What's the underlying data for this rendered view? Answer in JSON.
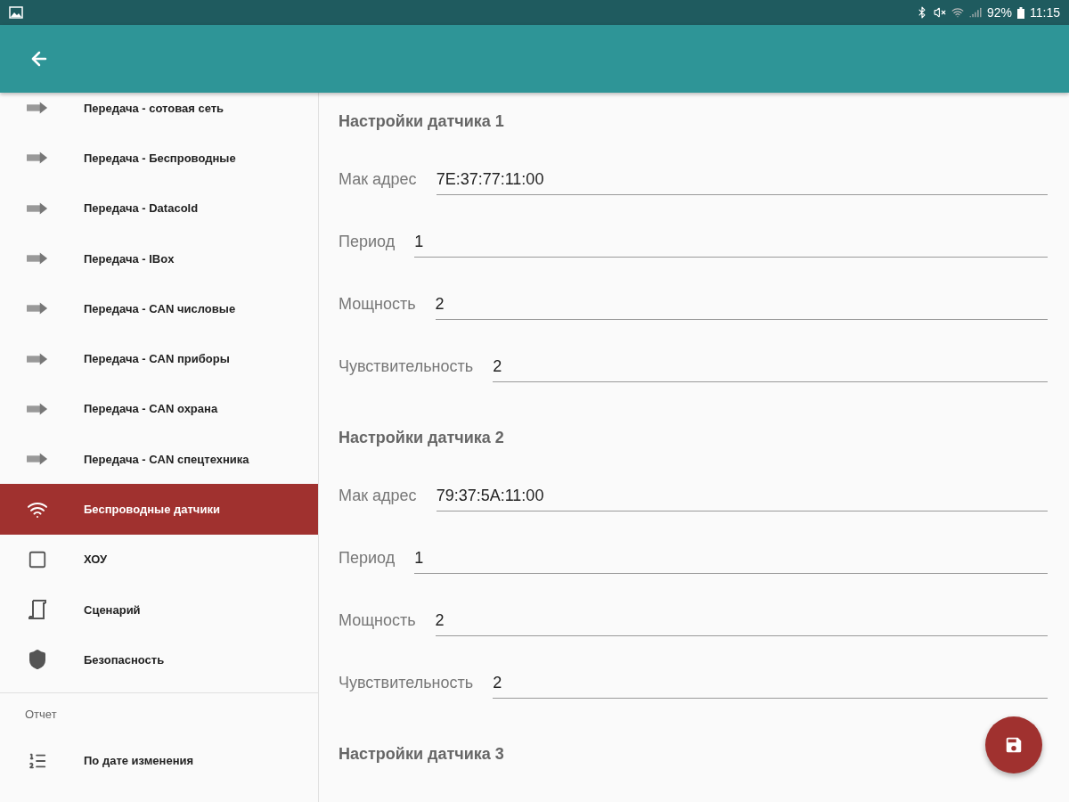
{
  "status_bar": {
    "battery_text": "92%",
    "time": "11:15"
  },
  "sidebar": {
    "items": [
      {
        "label": "Передача - сотовая сеть",
        "kind": "transfer",
        "selected": false
      },
      {
        "label": "Передача - Беспроводные",
        "kind": "transfer",
        "selected": false
      },
      {
        "label": "Передача - Datacold",
        "kind": "transfer",
        "selected": false
      },
      {
        "label": "Передача - IBox",
        "kind": "transfer",
        "selected": false
      },
      {
        "label": "Передача - CAN числовые",
        "kind": "transfer",
        "selected": false
      },
      {
        "label": "Передача - CAN приборы",
        "kind": "transfer",
        "selected": false
      },
      {
        "label": "Передача - CAN охрана",
        "kind": "transfer",
        "selected": false
      },
      {
        "label": "Передача - CAN спецтехника",
        "kind": "transfer",
        "selected": false
      },
      {
        "label": "Беспроводные датчики",
        "kind": "wireless",
        "selected": true
      },
      {
        "label": "ХОУ",
        "kind": "box",
        "selected": false
      },
      {
        "label": "Сценарий",
        "kind": "script",
        "selected": false
      },
      {
        "label": "Безопасность",
        "kind": "security",
        "selected": false
      }
    ],
    "report": {
      "title": "Отчет",
      "items": [
        {
          "label": "По дате изменения",
          "kind": "list",
          "selected": false
        }
      ]
    }
  },
  "sections": [
    {
      "title": "Настройки датчика 1",
      "fields": [
        {
          "label": "Мак адрес",
          "value": "7E:37:77:11:00"
        },
        {
          "label": "Период",
          "value": "1"
        },
        {
          "label": "Мощность",
          "value": "2"
        },
        {
          "label": "Чувствительность",
          "value": "2"
        }
      ]
    },
    {
      "title": "Настройки датчика 2",
      "fields": [
        {
          "label": "Мак адрес",
          "value": "79:37:5A:11:00"
        },
        {
          "label": "Период",
          "value": "1"
        },
        {
          "label": "Мощность",
          "value": "2"
        },
        {
          "label": "Чувствительность",
          "value": "2"
        }
      ]
    },
    {
      "title": "Настройки датчика 3"
    }
  ]
}
